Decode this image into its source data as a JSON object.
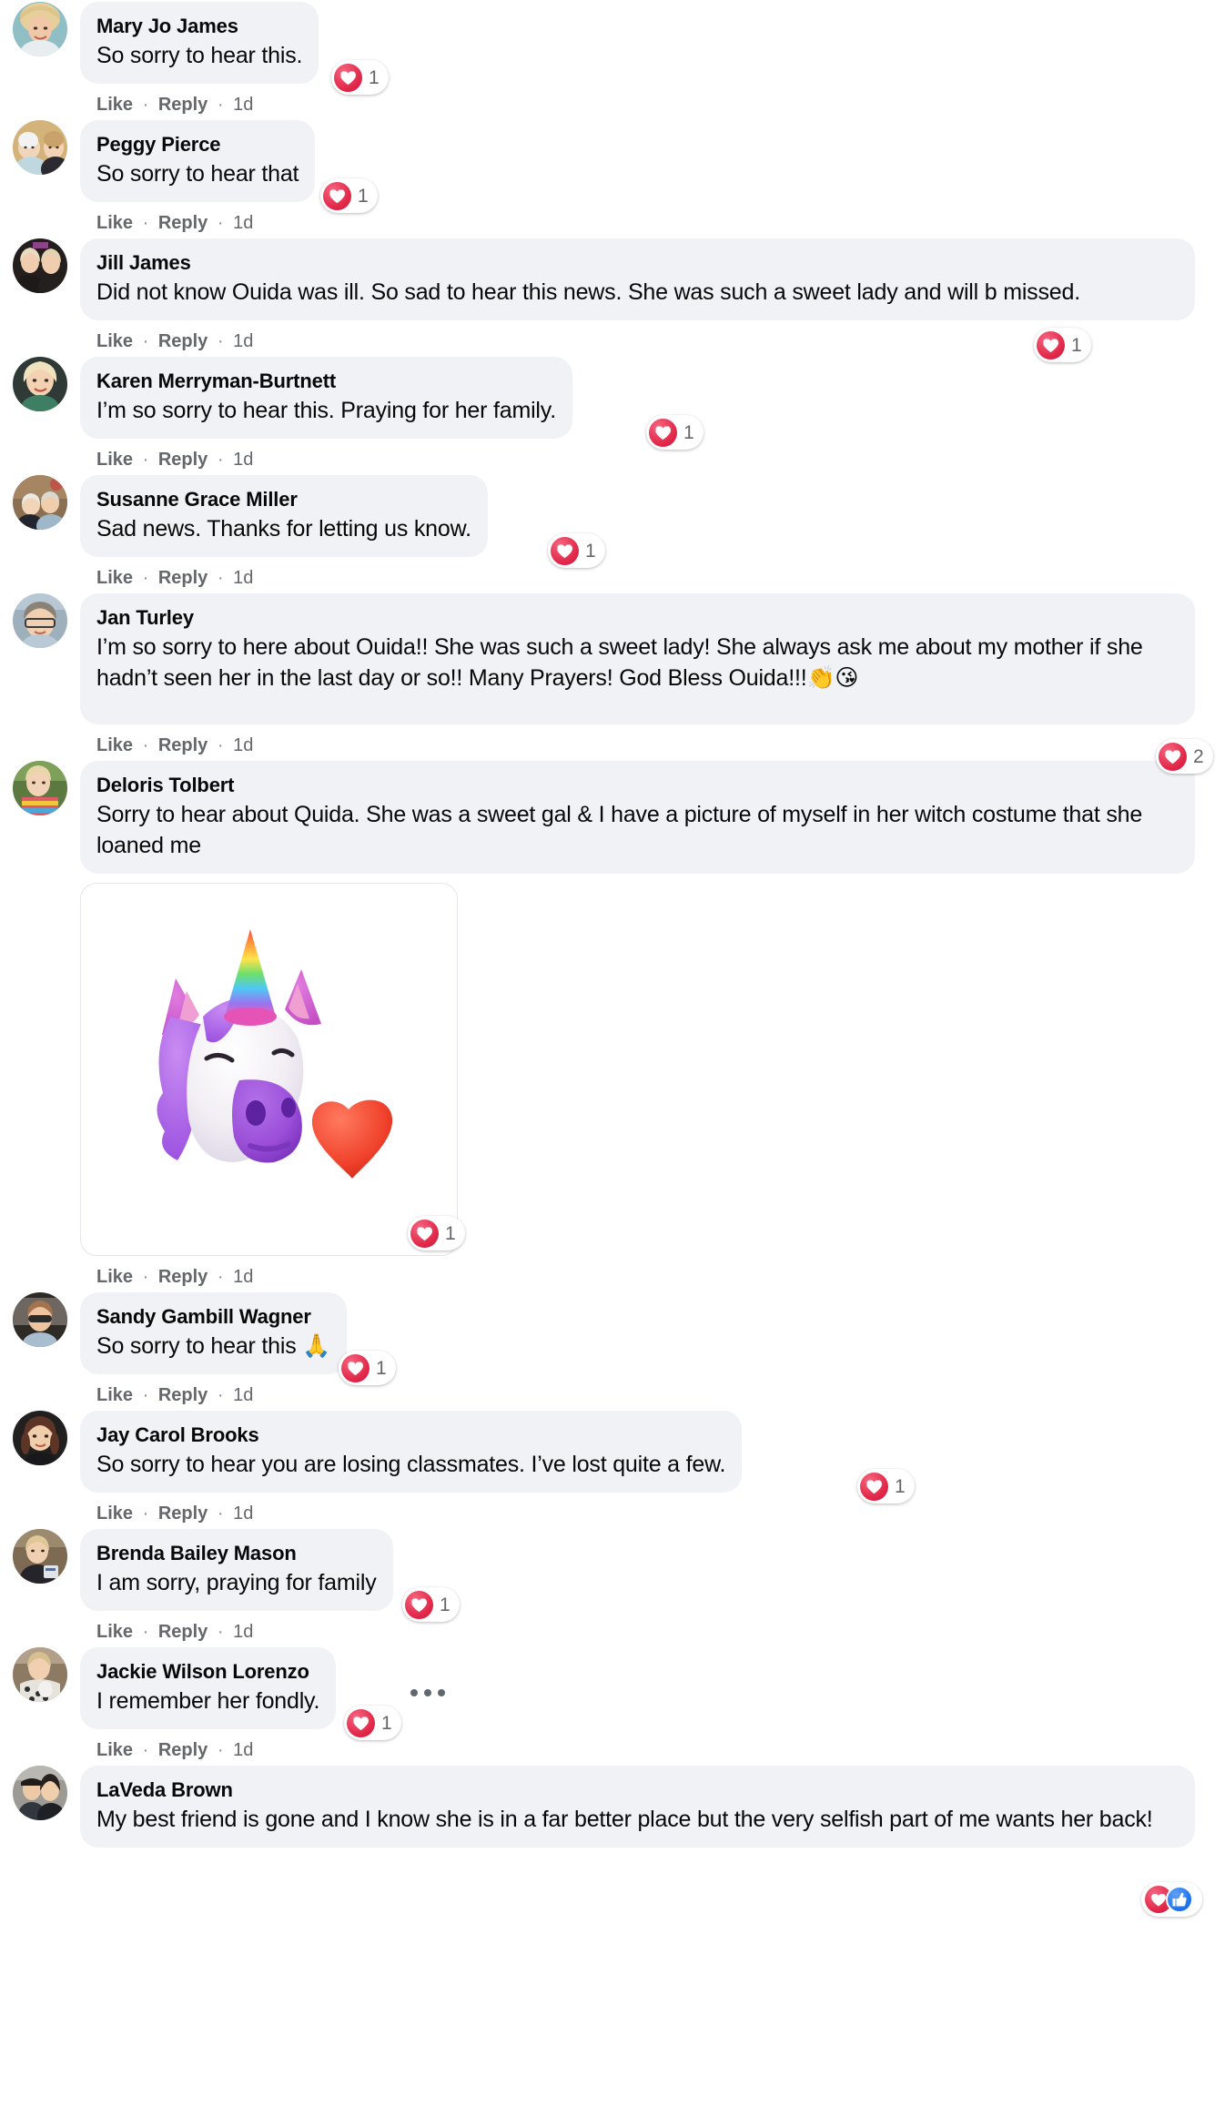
{
  "app": {
    "platform": "facebook-comments",
    "bubble_color": "#f0f2f5",
    "text_color": "#080809",
    "meta_color": "#65676b",
    "heart_color": "#e2294a",
    "like_color": "#2176f0"
  },
  "actions": {
    "like_label": "Like",
    "reply_label": "Reply",
    "separator": "·",
    "time_label": "1d",
    "more_icon": "ellipsis-horizontal-icon"
  },
  "comments": [
    {
      "author": "Mary Jo James",
      "text": "So sorry to hear this.",
      "time": "1d",
      "reaction": {
        "type": "love",
        "count": "1"
      },
      "avatar": "woman-blonde-teal-background"
    },
    {
      "author": "Peggy Pierce",
      "text": "So sorry to hear that",
      "time": "1d",
      "reaction": {
        "type": "love",
        "count": "1"
      },
      "avatar": "two-women-tan-background"
    },
    {
      "author": "Jill James",
      "text": "Did not know Ouida was ill. So sad to hear this news. She was such a sweet lady and will b missed.",
      "time": "1d",
      "reaction": {
        "type": "love",
        "count": "1"
      },
      "avatar": "two-blonde-women-dark-background"
    },
    {
      "author": "Karen Merryman-Burtnett",
      "text": "I’m so sorry to hear this. Praying for her family.",
      "time": "1d",
      "reaction": {
        "type": "love",
        "count": "1"
      },
      "avatar": "blonde-woman-green-top"
    },
    {
      "author": "Susanne Grace Miller",
      "text": "Sad news. Thanks for letting us know.",
      "time": "1d",
      "reaction": {
        "type": "love",
        "count": "1"
      },
      "avatar": "older-couple-indoors"
    },
    {
      "author": "Jan Turley",
      "text": "I’m so sorry to here about Ouida!! She was such a sweet lady! She always ask me about my mother if she hadn’t seen her in the last day or so!! Many Prayers! God Bless Ouida!!!",
      "text_emoji": "👏😘",
      "time": "1d",
      "reaction": {
        "type": "love",
        "count": "2"
      },
      "avatar": "woman-glasses-light-background"
    },
    {
      "author": "Deloris Tolbert",
      "text": "Sorry to hear about Quida. She was a sweet gal & I have a picture of myself in her witch costume that she loaned me",
      "time": "1d",
      "reaction": {
        "type": "love",
        "count": "1"
      },
      "avatar": "woman-outdoors-colorful-top",
      "attachment": {
        "type": "image",
        "description": "unicorn-memoji-with-red-heart"
      }
    },
    {
      "author": "Sandy Gambill Wagner",
      "text": "So sorry to hear this ",
      "text_emoji": "🙏",
      "time": "1d",
      "reaction": {
        "type": "love",
        "count": "1"
      },
      "avatar": "woman-sunglasses-in-car"
    },
    {
      "author": "Jay Carol Brooks",
      "text": "So sorry to hear you are losing classmates. I’ve lost quite a few.",
      "time": "1d",
      "reaction": {
        "type": "love",
        "count": "1"
      },
      "avatar": "woman-dark-hair-dark-background"
    },
    {
      "author": "Brenda Bailey Mason",
      "text": "I am sorry, praying for family",
      "time": "1d",
      "reaction": {
        "type": "love",
        "count": "1"
      },
      "avatar": "woman-blonde-indoor-event"
    },
    {
      "author": "Jackie Wilson Lorenzo",
      "text": "I remember her fondly.",
      "time": "1d",
      "reaction": {
        "type": "love",
        "count": "1"
      },
      "has_more_menu": true,
      "avatar": "woman-patterned-top-indoors"
    },
    {
      "author": "LaVeda Brown",
      "text": "My best friend is gone and I know she is in a far better place but the very selfish part of me wants her back!",
      "time": "1d",
      "reaction": {
        "type": "love-and-like",
        "count": ""
      },
      "avatar": "couple-with-hats-outdoors"
    }
  ]
}
